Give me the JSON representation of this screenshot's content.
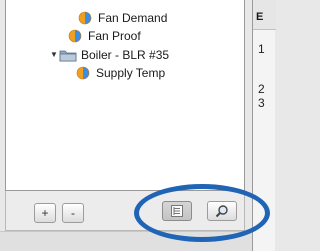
{
  "tree": {
    "items": [
      {
        "label": "Fan Demand",
        "icon": "point-icon",
        "indent": 1
      },
      {
        "label": "Fan Proof",
        "icon": "point-icon",
        "indent": 1
      },
      {
        "label": "Boiler - BLR #35",
        "icon": "folder-icon",
        "indent": 0,
        "expanded": true
      },
      {
        "label": "Supply Temp",
        "icon": "point-icon",
        "indent": 1
      }
    ]
  },
  "right_panel": {
    "header": "E",
    "rows": [
      "1",
      "2",
      "3"
    ]
  },
  "toolbar": {
    "add_label": "+",
    "remove_label": "-",
    "list_view_icon": "list-view-icon",
    "search_icon": "magnifier-icon"
  },
  "annotation": {
    "color": "#1f64b5"
  }
}
